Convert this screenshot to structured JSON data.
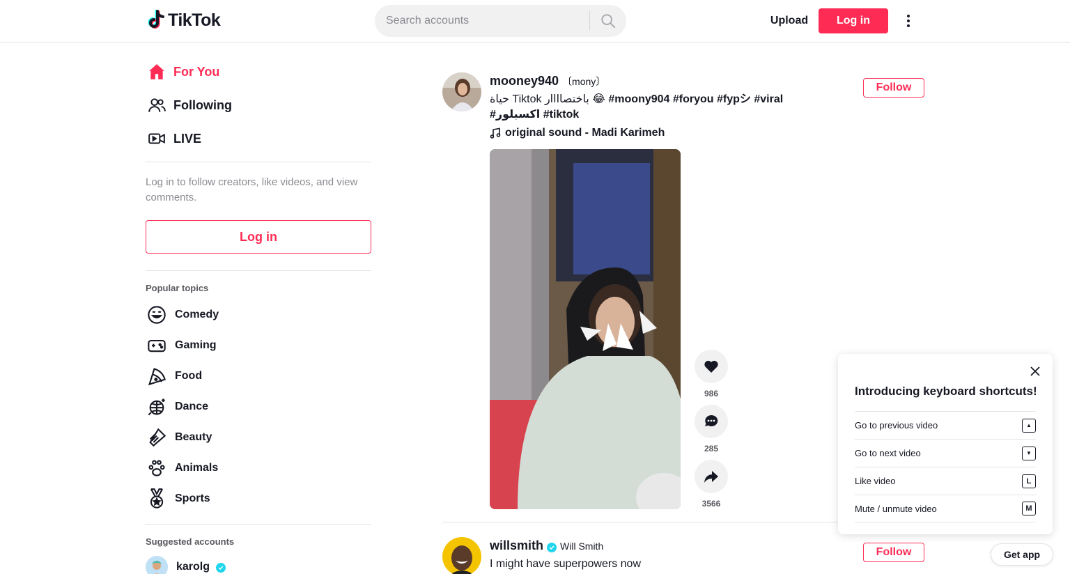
{
  "header": {
    "logo_text": "TikTok",
    "search_placeholder": "Search accounts",
    "upload_label": "Upload",
    "login_label": "Log in"
  },
  "sidebar": {
    "nav": [
      {
        "label": "For You",
        "icon": "home-icon",
        "active": true
      },
      {
        "label": "Following",
        "icon": "following-users-icon"
      },
      {
        "label": "LIVE",
        "icon": "live-camera-icon"
      }
    ],
    "login_prompt": "Log in to follow creators, like videos, and view comments.",
    "login_button": "Log in",
    "popular_topics_title": "Popular topics",
    "topics": [
      {
        "label": "Comedy",
        "icon": "smile-icon"
      },
      {
        "label": "Gaming",
        "icon": "gamepad-icon"
      },
      {
        "label": "Food",
        "icon": "pizza-icon"
      },
      {
        "label": "Dance",
        "icon": "disco-ball-icon"
      },
      {
        "label": "Beauty",
        "icon": "comb-icon"
      },
      {
        "label": "Animals",
        "icon": "paw-icon"
      },
      {
        "label": "Sports",
        "icon": "medal-icon"
      }
    ],
    "suggested_title": "Suggested accounts",
    "suggested": [
      {
        "username": "karolg",
        "verified": true
      }
    ]
  },
  "feed": {
    "posts": [
      {
        "username": "mooney940",
        "nickname": "mony",
        "caption_text": "حياة Tiktok باختصاااار 😂 ",
        "hashtags": "#moony904 #foryou #fypシ #viral #اكسبلور #tiktok",
        "music": "original sound - Madi Karimeh",
        "follow_label": "Follow",
        "likes": "986",
        "comments": "285",
        "shares": "3566"
      },
      {
        "username": "willsmith",
        "nickname": "Will Smith",
        "verified": true,
        "caption_text": "I might have superpowers now",
        "follow_label": "Follow"
      }
    ]
  },
  "shortcuts": {
    "title": "Introducing keyboard shortcuts!",
    "rows": [
      {
        "label": "Go to previous video",
        "key": "▲"
      },
      {
        "label": "Go to next video",
        "key": "▼"
      },
      {
        "label": "Like video",
        "key": "L"
      },
      {
        "label": "Mute / unmute video",
        "key": "M"
      }
    ]
  },
  "get_app_label": "Get app",
  "colors": {
    "brand": "#fe2c55",
    "text": "#161823",
    "muted": "#8a8b91",
    "verified": "#20d5ec"
  }
}
